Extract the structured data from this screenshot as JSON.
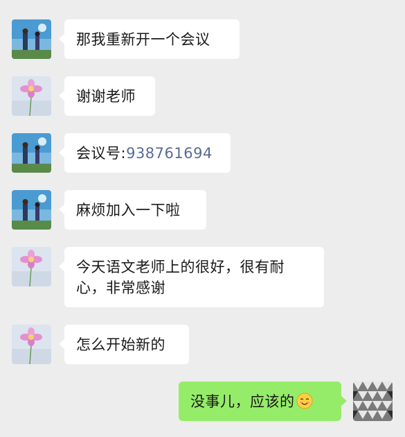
{
  "colors": {
    "background": "#ededed",
    "incoming_bubble": "#ffffff",
    "outgoing_bubble": "#95ec69",
    "link": "#576b95",
    "text": "#191919"
  },
  "messages": [
    {
      "sender": "contact-anime",
      "text": "那我重新开一个会议"
    },
    {
      "sender": "contact-flower",
      "text": "谢谢老师"
    },
    {
      "sender": "contact-anime",
      "prefix": "会议号:",
      "number": "938761694"
    },
    {
      "sender": "contact-anime",
      "text": "麻烦加入一下啦"
    },
    {
      "sender": "contact-flower",
      "line1": "今天语文老师上的很好，很有耐",
      "line2": "心，非常感谢"
    },
    {
      "sender": "contact-flower",
      "text": "怎么开始新的"
    },
    {
      "sender": "me",
      "text": "没事儿，应该的",
      "emoji": "smile-emoji"
    }
  ]
}
